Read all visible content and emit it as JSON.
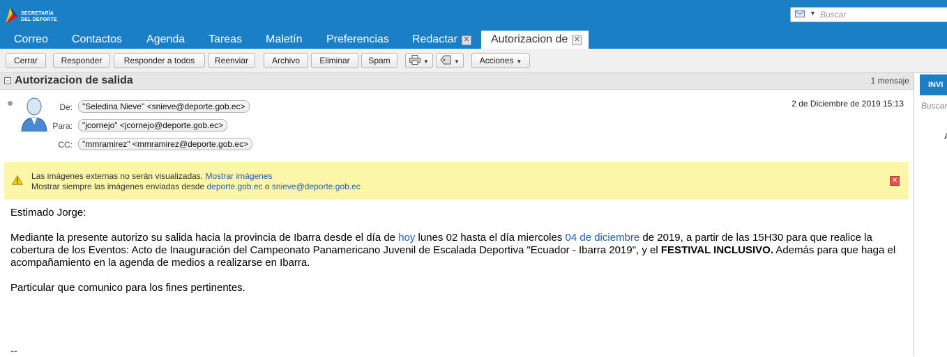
{
  "colors": {
    "header_blue": "#1a7fc5",
    "notice_yellow": "#fbf6a8",
    "link_blue": "#1f5eb3"
  },
  "logo": {
    "line1": "SECRETARÍA",
    "line2": "DEL DEPORTE"
  },
  "search": {
    "placeholder": "Buscar"
  },
  "tabs": [
    {
      "label": "Correo"
    },
    {
      "label": "Contactos"
    },
    {
      "label": "Agenda"
    },
    {
      "label": "Tareas"
    },
    {
      "label": "Maletín"
    },
    {
      "label": "Preferencias"
    },
    {
      "label": "Redactar"
    },
    {
      "label": "Autorizacion de"
    }
  ],
  "toolbar": {
    "close": "Cerrar",
    "reply": "Responder",
    "reply_all": "Responder a todos",
    "forward": "Reenviar",
    "archive": "Archivo",
    "delete": "Eliminar",
    "spam": "Spam",
    "print_icon": "printer-icon",
    "tag_icon": "tag-icon",
    "actions": "Acciones"
  },
  "conversation": {
    "title": "Autorizacion de salida",
    "count": "1 mensaje"
  },
  "message": {
    "from_label": "De:",
    "from": "\"Seledina Nieve\" <snieve@deporte.gob.ec>",
    "to_label": "Para:",
    "to": "\"jcornejo\" <jcornejo@deporte.gob.ec>",
    "cc_label": "CC:",
    "cc": "\"mmramirez\" <mmramirez@deporte.gob.ec>",
    "date": "2 de Diciembre de 2019 15:13"
  },
  "notice": {
    "line1": "Las imágenes externas no serán visualizadas.",
    "show_link": "Mostrar imágenes",
    "line2": "Mostrar siempre las imágenes enviadas desde",
    "domain_link": "deporte.gob.ec",
    "or": "o",
    "sender_link": "snieve@deporte.gob.ec"
  },
  "body": {
    "greeting": "Estimado Jorge:",
    "p1_a": "Mediante la presente autorizo su salida hacia la provincia de Ibarra desde el día de",
    "p1_link1": "hoy",
    "p1_b": "lunes 02 hasta el día miercoles",
    "p1_link2": "04 de diciembre",
    "p1_c": "de 2019, a partir de las 15H30 para que realice la cobertura de los Eventos: Acto de Inauguración del Campeonato Panamericano Juvenil de Escalada Deportiva \"Ecuador - Ibarra 2019\", y el",
    "p1_bold": "FESTIVAL INCLUSIVO.",
    "p1_d": "Además para que haga el acompañamiento en la agenda de medios a realizarse en Ibarra.",
    "closing": "Particular que comunico para los fines pertinentes.",
    "signature": "--"
  },
  "rightpane": {
    "button": "INVI",
    "search": "Buscar",
    "letter": "A"
  }
}
